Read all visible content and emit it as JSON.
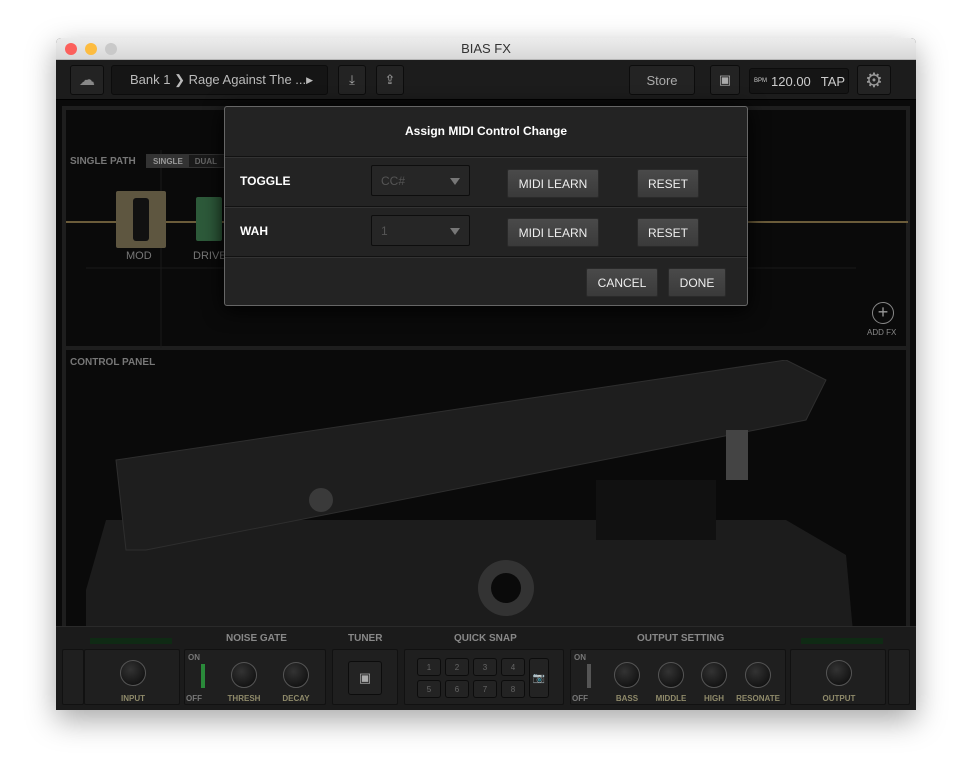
{
  "window": {
    "title": "BIAS FX"
  },
  "toolbar": {
    "preset": "Bank 1 ❯ Rage Against The ...",
    "store": "Store",
    "bpm_label": "BPM",
    "bpm": "120.00",
    "tap": "TAP"
  },
  "canvas": {
    "path_label": "SINGLE PATH",
    "path_single": "SINGLE",
    "path_dual": "DUAL",
    "mod": "MOD",
    "drive": "DRIVE",
    "add_fx": "ADD FX",
    "control_panel": "CONTROL PANEL"
  },
  "modal": {
    "title": "Assign MIDI Control Change",
    "rows": [
      {
        "label": "TOGGLE",
        "value": "CC#",
        "learn": "MIDI LEARN",
        "reset": "RESET"
      },
      {
        "label": "WAH",
        "value": "1",
        "learn": "MIDI LEARN",
        "reset": "RESET"
      }
    ],
    "cancel": "CANCEL",
    "done": "DONE"
  },
  "bottom": {
    "noise_gate": "NOISE GATE",
    "tuner": "TUNER",
    "quick_snap": "QUICK SNAP",
    "output_setting": "OUTPUT SETTING",
    "input": "INPUT",
    "on": "ON",
    "off": "OFF",
    "thresh": "THRESH",
    "decay": "DECAY",
    "bass": "BASS",
    "middle": "MIDDLE",
    "high": "HIGH",
    "resonate": "RESONATE",
    "output": "OUTPUT",
    "snaps": [
      "1",
      "2",
      "3",
      "4",
      "5",
      "6",
      "7",
      "8"
    ]
  },
  "colors": {
    "accent": "#c8b27a",
    "bg": "#0a0a0a"
  }
}
